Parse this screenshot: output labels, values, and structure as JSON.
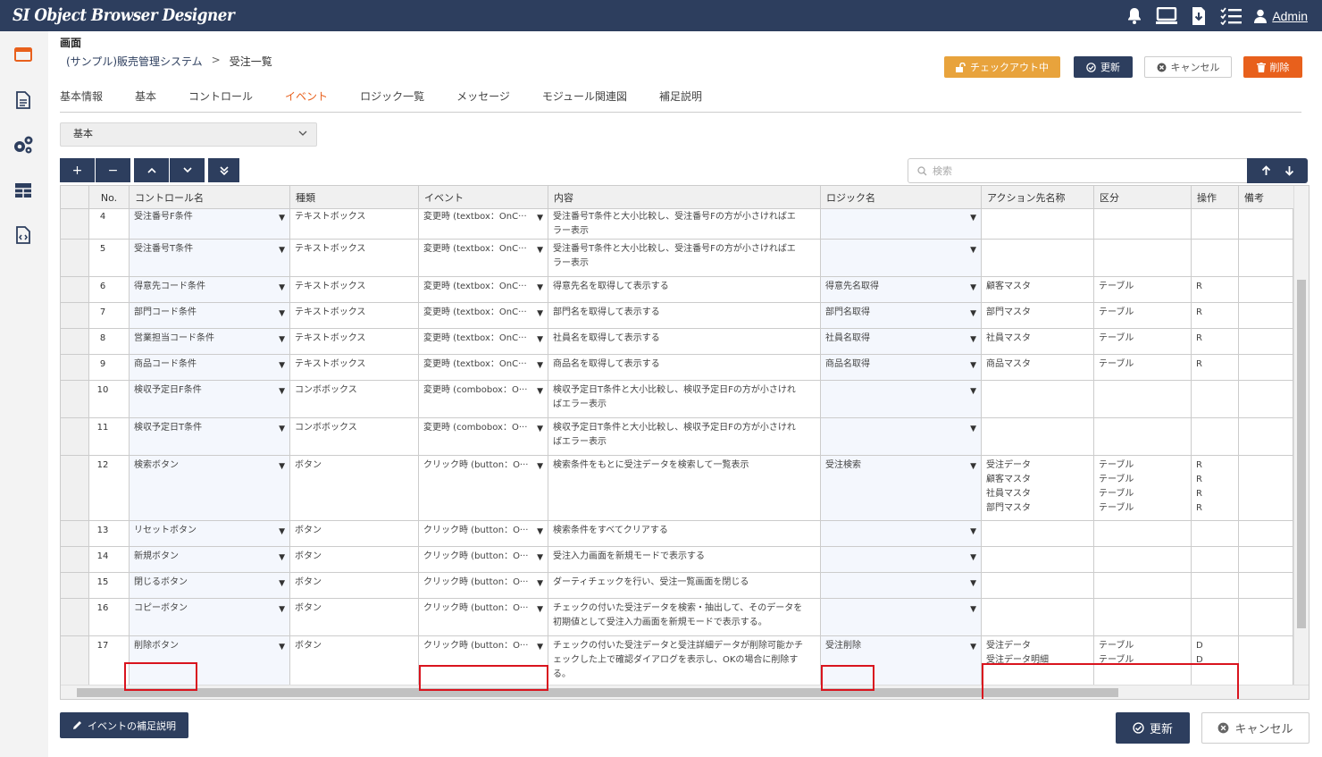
{
  "app": {
    "title": "SI Object Browser Designer",
    "user": "Admin"
  },
  "page": {
    "label": "画面",
    "breadcrumb": [
      "(サンプル)販売管理システム",
      ">",
      "受注一覧"
    ]
  },
  "header_buttons": {
    "checkout": "チェックアウト中",
    "update": "更新",
    "cancel": "キャンセル",
    "delete": "削除"
  },
  "tabs": [
    "基本情報",
    "基本",
    "コントロール",
    "イベント",
    "ロジック一覧",
    "メッセージ",
    "モジュール関連図",
    "補足説明"
  ],
  "active_tab": "イベント",
  "filter_select": {
    "value": "基本"
  },
  "toolbar": {
    "add": "+",
    "remove": "−"
  },
  "search": {
    "placeholder": "検索"
  },
  "columns": [
    "",
    "No.",
    "コントロール名",
    "種類",
    "イベント",
    "内容",
    "ロジック名",
    "アクション先名称",
    "区分",
    "操作",
    "備考"
  ],
  "rows": [
    {
      "no": "4",
      "control": "受注番号F条件",
      "type": "テキストボックス",
      "event": "変更時 (textbox：OnC···",
      "content": "受注番号T条件と大小比較し、受注番号Fの方が小さければエラー表示",
      "logic": "",
      "action": "",
      "kubun": "",
      "op": ""
    },
    {
      "no": "5",
      "control": "受注番号T条件",
      "type": "テキストボックス",
      "event": "変更時 (textbox：OnC···",
      "content": "受注番号T条件と大小比較し、受注番号Fの方が小さければエラー表示",
      "logic": "",
      "action": "",
      "kubun": "",
      "op": ""
    },
    {
      "no": "6",
      "control": "得意先コード条件",
      "type": "テキストボックス",
      "event": "変更時 (textbox：OnC···",
      "content": "得意先名を取得して表示する",
      "logic": "得意先名取得",
      "action": "顧客マスタ",
      "kubun": "テーブル",
      "op": "R"
    },
    {
      "no": "7",
      "control": "部門コード条件",
      "type": "テキストボックス",
      "event": "変更時 (textbox：OnC···",
      "content": "部門名を取得して表示する",
      "logic": "部門名取得",
      "action": "部門マスタ",
      "kubun": "テーブル",
      "op": "R"
    },
    {
      "no": "8",
      "control": "営業担当コード条件",
      "type": "テキストボックス",
      "event": "変更時 (textbox：OnC···",
      "content": "社員名を取得して表示する",
      "logic": "社員名取得",
      "action": "社員マスタ",
      "kubun": "テーブル",
      "op": "R"
    },
    {
      "no": "9",
      "control": "商品コード条件",
      "type": "テキストボックス",
      "event": "変更時 (textbox：OnC···",
      "content": "商品名を取得して表示する",
      "logic": "商品名取得",
      "action": "商品マスタ",
      "kubun": "テーブル",
      "op": "R"
    },
    {
      "no": "10",
      "control": "検収予定日F条件",
      "type": "コンボボックス",
      "event": "変更時 (combobox：O···",
      "content": "検収予定日T条件と大小比較し、検収予定日Fの方が小さければエラー表示",
      "logic": "",
      "action": "",
      "kubun": "",
      "op": ""
    },
    {
      "no": "11",
      "control": "検収予定日T条件",
      "type": "コンボボックス",
      "event": "変更時 (combobox：O···",
      "content": "検収予定日T条件と大小比較し、検収予定日Fの方が小さければエラー表示",
      "logic": "",
      "action": "",
      "kubun": "",
      "op": ""
    },
    {
      "no": "12",
      "control": "検索ボタン",
      "type": "ボタン",
      "event": "クリック時 (button：O···",
      "content": "検索条件をもとに受注データを検索して一覧表示",
      "logic": "受注検索",
      "action": "受注データ\n顧客マスタ\n社員マスタ\n部門マスタ",
      "kubun": "テーブル\nテーブル\nテーブル\nテーブル",
      "op": "R\nR\nR\nR"
    },
    {
      "no": "13",
      "control": "リセットボタン",
      "type": "ボタン",
      "event": "クリック時 (button：O···",
      "content": "検索条件をすべてクリアする",
      "logic": "",
      "action": "",
      "kubun": "",
      "op": ""
    },
    {
      "no": "14",
      "control": "新規ボタン",
      "type": "ボタン",
      "event": "クリック時 (button：O···",
      "content": "受注入力画面を新規モードで表示する",
      "logic": "",
      "action": "",
      "kubun": "",
      "op": ""
    },
    {
      "no": "15",
      "control": "閉じるボタン",
      "type": "ボタン",
      "event": "クリック時 (button：O···",
      "content": "ダーティチェックを行い、受注一覧画面を閉じる",
      "logic": "",
      "action": "",
      "kubun": "",
      "op": ""
    },
    {
      "no": "16",
      "control": "コピーボタン",
      "type": "ボタン",
      "event": "クリック時 (button：O···",
      "content": "チェックの付いた受注データを検索・抽出して、そのデータを初期値として受注入力画面を新規モードで表示する。",
      "logic": "",
      "action": "",
      "kubun": "",
      "op": ""
    },
    {
      "no": "17",
      "control": "削除ボタン",
      "type": "ボタン",
      "event": "クリック時 (button：O···",
      "content": "チェックの付いた受注データと受注詳細データが削除可能かチェックした上で確認ダイアログを表示し、OKの場合に削除する。",
      "logic": "受注削除",
      "action": "受注データ\n受注データ明細",
      "kubun": "テーブル\nテーブル",
      "op": "D\nD"
    }
  ],
  "footer": {
    "supplement": "イベントの補足説明",
    "update": "更新",
    "cancel": "キャンセル"
  },
  "colors": {
    "navy": "#2d3e5e",
    "orange": "#e8a33c",
    "red_orange": "#e8601c",
    "highlight": "#d9141e"
  }
}
